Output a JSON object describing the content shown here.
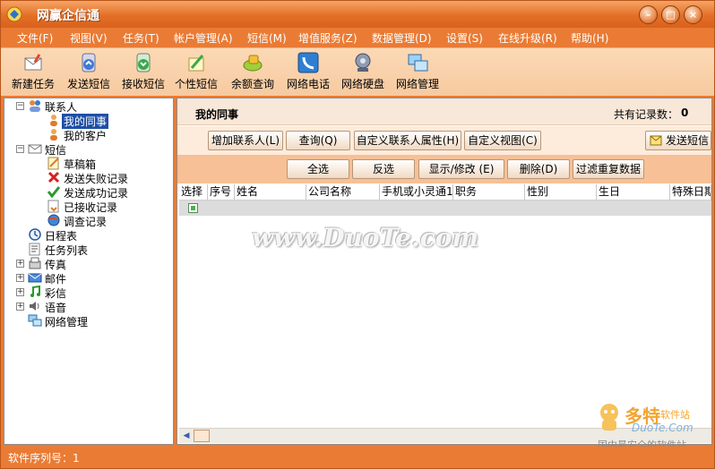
{
  "window": {
    "title": "网赢企信通",
    "buttons": {
      "minimize": "–",
      "maximize": "□",
      "close": "×"
    }
  },
  "menu": [
    "文件(F)",
    "视图(V)",
    "任务(T)",
    "帐户管理(A)",
    "短信(M)",
    "增值服务(Z)",
    "数据管理(D)",
    "设置(S)",
    "在线升级(R)",
    "帮助(H)"
  ],
  "toolbar": [
    {
      "label": "新建任务",
      "icon": "new-task-icon"
    },
    {
      "label": "发送短信",
      "icon": "send-sms-icon"
    },
    {
      "label": "接收短信",
      "icon": "receive-sms-icon"
    },
    {
      "label": "个性短信",
      "icon": "custom-sms-icon"
    },
    {
      "label": "余额查询",
      "icon": "balance-icon"
    },
    {
      "label": "网络电话",
      "icon": "phone-icon"
    },
    {
      "label": "网络硬盘",
      "icon": "netdisk-icon"
    },
    {
      "label": "网络管理",
      "icon": "network-icon"
    }
  ],
  "tree": {
    "contacts": "联系人",
    "my_colleagues": "我的同事",
    "my_clients": "我的客户",
    "sms": "短信",
    "drafts": "草稿箱",
    "send_failed": "发送失败记录",
    "send_success": "发送成功记录",
    "received": "已接收记录",
    "survey": "调查记录",
    "schedule": "日程表",
    "tasks": "任务列表",
    "fax": "传真",
    "mail": "邮件",
    "mms": "彩信",
    "voice": "语音",
    "net_manage": "网络管理"
  },
  "main": {
    "title": "我的同事",
    "record_count_label": "共有记录数：",
    "record_count": "0",
    "buttons_row1": [
      "增加联系人(L)",
      "查询(Q)",
      "自定义联系人属性(H)",
      "自定义视图(C)"
    ],
    "send_sms_button": "发送短信",
    "buttons_row2": [
      "全选",
      "反选",
      "显示/修改 (E)",
      "删除(D)",
      "过滤重复数据"
    ],
    "columns": [
      "选择",
      "序号",
      "姓名",
      "公司名称",
      "手机或小灵通1",
      "职务",
      "性别",
      "生日",
      "特殊日期"
    ]
  },
  "status": {
    "text": "软件序列号：1"
  },
  "watermark": "www.DuoTe.com",
  "corner_logo": {
    "brand": "多特",
    "suffix": "软件站",
    "url": "DuoTe.Com",
    "slogan": "国内最安全的软件站"
  },
  "colors": {
    "frame": "#ea7b34",
    "toolbar": "#fbd9b6",
    "selection": "#1f4fa6"
  }
}
